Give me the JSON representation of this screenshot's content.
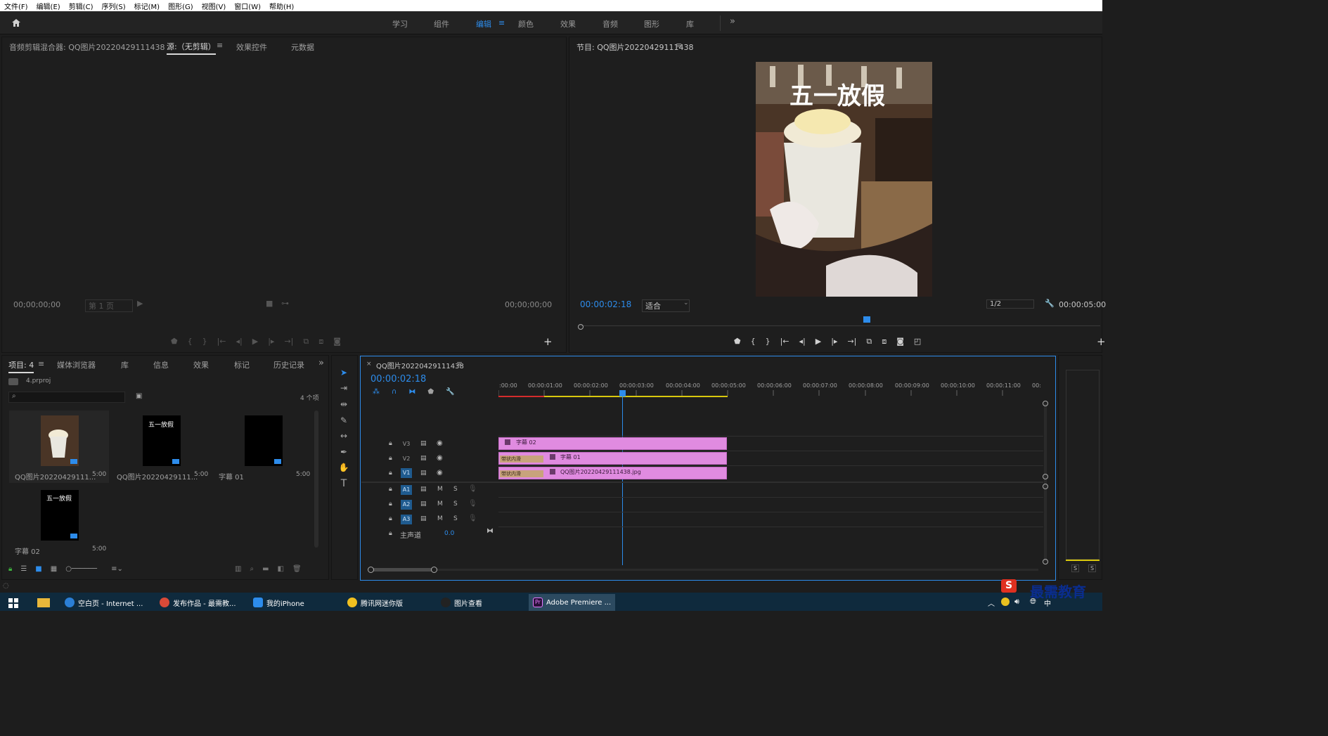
{
  "menu": [
    "文件(F)",
    "编辑(E)",
    "剪辑(C)",
    "序列(S)",
    "标记(M)",
    "图形(G)",
    "视图(V)",
    "窗口(W)",
    "帮助(H)"
  ],
  "workspaces": [
    "学习",
    "组件",
    "编辑",
    "颜色",
    "效果",
    "音频",
    "图形",
    "库"
  ],
  "workspace_active": "编辑",
  "source_panel": {
    "tabs": [
      "音频剪辑混合器: QQ图片20220429111438",
      "源:（无剪辑）",
      "效果控件",
      "元数据"
    ],
    "tc_left": "00;00;00;00",
    "page_select": "第 1 页",
    "tc_right": "00;00;00;00"
  },
  "program_panel": {
    "title": "节目: QQ图片20220429111438",
    "timecode": "00:00:02:18",
    "fit": "适合",
    "resolution": "1/2",
    "duration": "00:00:05:00",
    "overlay_text": "五一放假"
  },
  "project_panel": {
    "tabs": [
      "项目: 4",
      "媒体浏览器",
      "库",
      "信息",
      "效果",
      "标记",
      "历史记录"
    ],
    "file": "4.prproj",
    "count": "4 个项",
    "items": [
      {
        "name": "QQ图片20220429111...",
        "dur": "5:00",
        "thumb_text": ""
      },
      {
        "name": "QQ图片20220429111...",
        "dur": "5:00",
        "thumb_text": "五一放假"
      },
      {
        "name": "字幕 01",
        "dur": "5:00",
        "thumb_text": ""
      },
      {
        "name": "字幕 02",
        "dur": "5:00",
        "thumb_text": "五一放假"
      }
    ]
  },
  "timeline": {
    "tab": "QQ图片20220429111438",
    "timecode": "00:00:02:18",
    "ruler": [
      ":00:00",
      "00:00:01:00",
      "00:00:02:00",
      "00:00:03:00",
      "00:00:04:00",
      "00:00:05:00",
      "00:00:06:00",
      "00:00:07:00",
      "00:00:08:00",
      "00:00:09:00",
      "00:00:10:00",
      "00:00:11:00",
      "00:"
    ],
    "video_tracks": [
      "V3",
      "V2",
      "V1"
    ],
    "audio_tracks": [
      "A1",
      "A2",
      "A3"
    ],
    "master_label": "主声道",
    "master_value": "0.0",
    "clips": {
      "v3": "字幕 02",
      "v2": "字幕 01",
      "v1": "QQ图片20220429111438.jpg",
      "fx_label": "带状内滑"
    },
    "track_buttons": {
      "m": "M",
      "s": "S"
    }
  },
  "audio_meter": {
    "s1": "S",
    "s2": "S"
  },
  "taskbar": {
    "items": [
      "空白页 - Internet ...",
      "发布作品 - 最需教...",
      "我的iPhone",
      "腾讯网迷你版",
      "图片查看",
      "Adobe Premiere ..."
    ],
    "tray_text": "中",
    "watermark": "最需教育"
  }
}
